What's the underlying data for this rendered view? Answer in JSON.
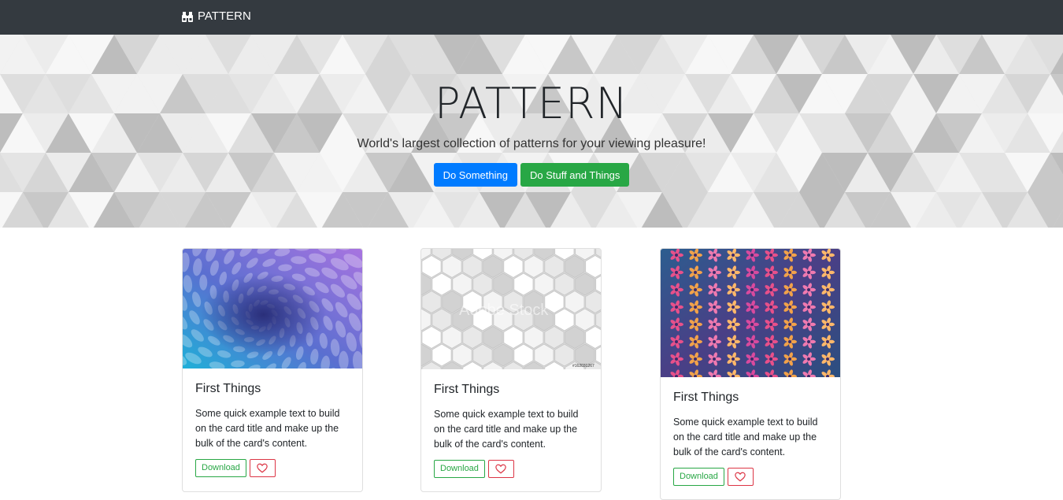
{
  "navbar": {
    "brand_label": "PATTERN",
    "brand_icon": "binoculars-icon",
    "background": "#343a40"
  },
  "hero": {
    "title": "PATTERN",
    "subtitle": "World's largest collection of patterns for your viewing pleasure!",
    "primary_button_label": "Do Something",
    "secondary_button_label": "Do Stuff and Things"
  },
  "colors": {
    "primary": "#007bff",
    "success": "#28a745",
    "danger": "#dc3545"
  },
  "cards": [
    {
      "image": "blue-purple-petal-swirl-pattern",
      "title": "First Things",
      "text": "Some quick example text to build on the card title and make up the bulk of the card's content.",
      "download_label": "Download",
      "like_icon": "heart-icon"
    },
    {
      "image": "white-hexagon-pattern",
      "image_watermark": "Adobe Stock",
      "image_id_text": "#162031267",
      "title": "First Things",
      "text": "Some quick example text to build on the card title and make up the bulk of the card's content.",
      "download_label": "Download",
      "like_icon": "heart-icon"
    },
    {
      "image": "floral-damask-pattern",
      "title": "First Things",
      "text": "Some quick example text to build on the card title and make up the bulk of the card's content.",
      "download_label": "Download",
      "like_icon": "heart-icon"
    }
  ]
}
